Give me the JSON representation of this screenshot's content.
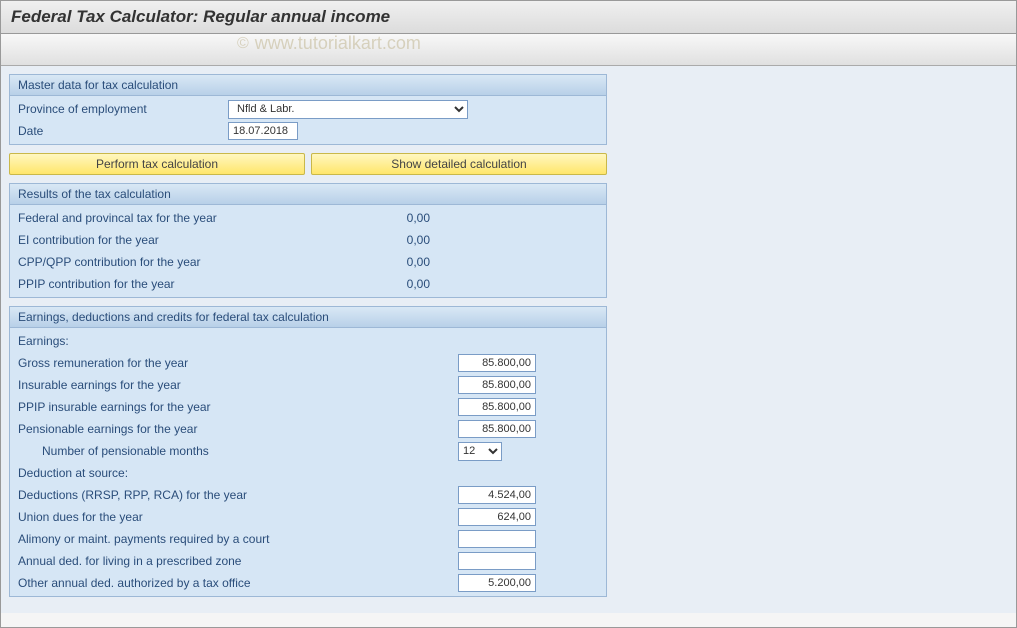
{
  "header": {
    "title": "Federal Tax Calculator: Regular annual income"
  },
  "watermark": {
    "text": "www.tutorialkart.com",
    "copyright": "©"
  },
  "master_data": {
    "title": "Master data for tax calculation",
    "province_label": "Province of employment",
    "province_value": "Nfld & Labr.",
    "date_label": "Date",
    "date_value": "18.07.2018"
  },
  "buttons": {
    "perform": "Perform tax calculation",
    "detailed": "Show detailed calculation"
  },
  "results": {
    "title": "Results of the tax calculation",
    "rows": [
      {
        "label": "Federal and provincal tax for the year",
        "value": "0,00"
      },
      {
        "label": "EI contribution for the year",
        "value": "0,00"
      },
      {
        "label": "CPP/QPP contribution for the year",
        "value": "0,00"
      },
      {
        "label": "PPIP contribution for the year",
        "value": "0,00"
      }
    ]
  },
  "earnings": {
    "title": "Earnings, deductions and credits for federal tax calculation",
    "earnings_header": "Earnings:",
    "gross_label": "Gross remuneration for the year",
    "gross_value": "85.800,00",
    "insurable_label": "Insurable earnings for the year",
    "insurable_value": "85.800,00",
    "ppip_label": "PPIP insurable earnings for the year",
    "ppip_value": "85.800,00",
    "pensionable_label": "Pensionable earnings for the year",
    "pensionable_value": "85.800,00",
    "months_label": "Number of pensionable months",
    "months_value": "12",
    "deduction_header": "Deduction at source:",
    "rrsp_label": "Deductions (RRSP, RPP, RCA) for the year",
    "rrsp_value": "4.524,00",
    "union_label": "Union dues for the year",
    "union_value": "624,00",
    "alimony_label": "Alimony or maint. payments required by a court",
    "alimony_value": "",
    "zone_label": "Annual ded. for living in a prescribed zone",
    "zone_value": "",
    "other_label": "Other annual ded. authorized by a tax office",
    "other_value": "5.200,00"
  }
}
